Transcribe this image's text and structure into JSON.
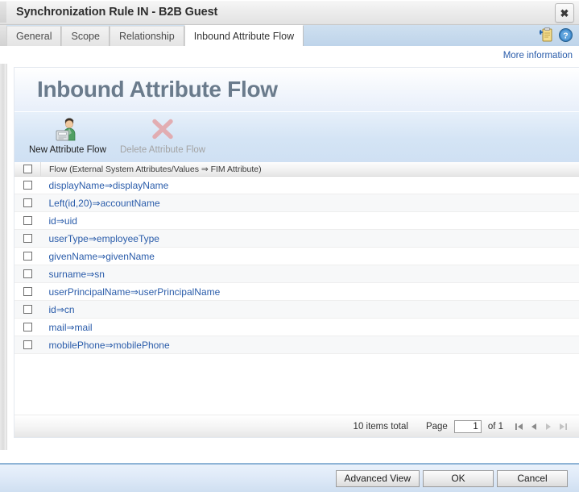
{
  "window": {
    "title": "Synchronization Rule IN - B2B Guest",
    "close_label": "✖"
  },
  "tabs": [
    {
      "label": "General",
      "active": false
    },
    {
      "label": "Scope",
      "active": false
    },
    {
      "label": "Relationship",
      "active": false
    },
    {
      "label": "Inbound Attribute Flow",
      "active": true
    }
  ],
  "tabstrip_icons": [
    {
      "name": "add-clipboard-icon"
    },
    {
      "name": "help-icon"
    }
  ],
  "more_information": {
    "label": "More information"
  },
  "banner": {
    "title": "Inbound Attribute Flow"
  },
  "toolbar": {
    "new_label": "New Attribute Flow",
    "delete_label": "Delete Attribute Flow"
  },
  "table": {
    "header": "Flow (External System Attributes/Values ⇒ FIM Attribute)",
    "rows": [
      {
        "flow": "displayName⇒displayName"
      },
      {
        "flow": "Left(id,20)⇒accountName"
      },
      {
        "flow": "id⇒uid"
      },
      {
        "flow": "userType⇒employeeType"
      },
      {
        "flow": "givenName⇒givenName"
      },
      {
        "flow": "surname⇒sn"
      },
      {
        "flow": "userPrincipalName⇒userPrincipalName"
      },
      {
        "flow": "id⇒cn"
      },
      {
        "flow": "mail⇒mail"
      },
      {
        "flow": "mobilePhone⇒mobilePhone"
      }
    ]
  },
  "paging": {
    "items_total": "10 items total",
    "page_label": "Page",
    "page_value": "1",
    "of_label": "of 1"
  },
  "footer": {
    "advanced_view": "Advanced View",
    "ok": "OK",
    "cancel": "Cancel"
  },
  "colors": {
    "link": "#2a5caa",
    "banner_text": "#6a7b8c",
    "tab_active_bg": "#ffffff",
    "tabstrip_bg": "#c6d9ec",
    "toolbar_bg": "#d4e4f5",
    "footer_border": "#8fb4d6"
  }
}
